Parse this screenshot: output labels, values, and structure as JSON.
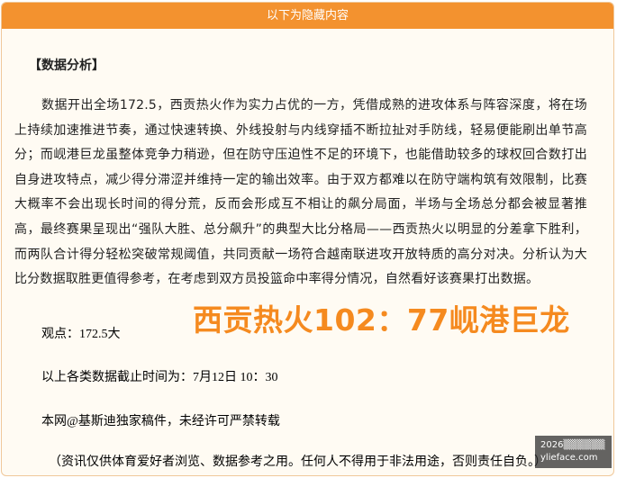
{
  "header": {
    "title": "以下为隐藏内容"
  },
  "article": {
    "section_title": "【数据分析】",
    "body": "数据开出全场172.5，西贡热火作为实力占优的一方，凭借成熟的进攻体系与阵容深度，将在场上持续加速推进节奏，通过快速转换、外线投射与内线穿插不断拉扯对手防线，轻易便能刷出单节高分；而岘港巨龙虽整体竞争力稍逊，但在防守压迫性不足的环境下，也能借助较多的球权回合数打出自身进攻特点，减少得分滞涩并维持一定的输出效率。由于双方都难以在防守端构筑有效限制，比赛大概率不会出现长时间的得分荒，反而会形成互不相让的飙分局面，半场与全场总分都会被显著推高，最终赛果呈现出“强队大胜、总分飙升”的典型大比分格局——西贡热火以明显的分差拿下胜利，而两队合计得分轻松突破常规阈值，共同贡献一场符合越南联进攻开放特质的高分对决。分析认为大比分数据取胜更值得参考，在考虑到双方员投篮命中率得分情况，自然看好该赛果打出数据。",
    "viewpoint": "观点：172.5大",
    "deadline": "以上各类数据截止时间为：7月12日 10：30",
    "copyright": "本网@基斯迪独家稿件，未经许可严禁转载",
    "disclaimer": "（资讯仅供体育爱好者浏览、数据参考之用。任何人不得用于非法用途，否则责任自负。）"
  },
  "overlay": {
    "score_text": "西贡热火102：77岘港巨龙"
  },
  "watermark": {
    "line1": "2026▒▒▒▒▒▒",
    "line2": "ylieface.com"
  },
  "colors": {
    "accent": "#f3922f",
    "score": "#f58a1f",
    "panel_bg": "#fffbf3"
  }
}
